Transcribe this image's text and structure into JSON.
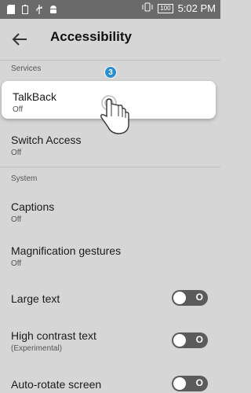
{
  "status_bar": {
    "time": "5:02 PM",
    "battery": "100",
    "icons": [
      "sd-card-icon",
      "battery-small-icon",
      "usb-icon",
      "android-icon",
      "vibrate-icon",
      "signal-icon"
    ]
  },
  "header": {
    "title": "Accessibility",
    "back_icon": "back-arrow-icon"
  },
  "sections": {
    "services": "Services",
    "system": "System"
  },
  "items": {
    "talkback": {
      "label": "TalkBack",
      "sub": "Off"
    },
    "switch_access": {
      "label": "Switch Access",
      "sub": "Off"
    },
    "captions": {
      "label": "Captions",
      "sub": "Off"
    },
    "magnification": {
      "label": "Magnification gestures",
      "sub": "Off"
    },
    "large_text": {
      "label": "Large text",
      "toggle": "O",
      "on": false
    },
    "high_contrast": {
      "label": "High contrast text",
      "sub": "(Experimental)",
      "toggle": "O",
      "on": false
    },
    "auto_rotate": {
      "label": "Auto-rotate screen",
      "toggle": "O",
      "on": false
    }
  },
  "tutorial": {
    "step_badge": "3",
    "hand_icon": "tap-hand-icon"
  },
  "colors": {
    "background": "#d6d6d6",
    "status_bar": "#6a6a6a",
    "badge": "#2a8fd0",
    "toggle_off": "#5b5b5b"
  }
}
